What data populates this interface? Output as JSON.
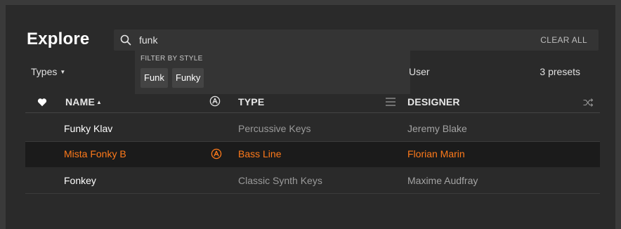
{
  "colors": {
    "accent": "#ff7a1a",
    "panel": "#2a2a2a",
    "selected_row": "#1b1b1b"
  },
  "header": {
    "title": "Explore"
  },
  "search": {
    "value": "funk",
    "clear_label": "CLEAR ALL",
    "icon": "search-icon"
  },
  "filter": {
    "heading": "FILTER BY STYLE",
    "chips": [
      "Funk",
      "Funky"
    ]
  },
  "toolbar": {
    "types_label": "Types",
    "user_label": "User",
    "preset_count": "3 presets"
  },
  "columns": {
    "favorite_icon": "heart-icon",
    "name": "NAME",
    "name_sort_icon": "sort-ascending-icon",
    "arturia_icon": "arturia-logo-icon",
    "type": "TYPE",
    "type_menu_icon": "list-icon",
    "designer": "DESIGNER",
    "shuffle_icon": "shuffle-icon"
  },
  "presets": [
    {
      "name": "Funky Klav",
      "type": "Percussive Keys",
      "designer": "Jeremy Blake",
      "factory": false,
      "selected": false
    },
    {
      "name": "Mista Fonky B",
      "type": "Bass Line",
      "designer": "Florian Marin",
      "factory": true,
      "selected": true
    },
    {
      "name": "Fonkey",
      "type": "Classic Synth Keys",
      "designer": "Maxime Audfray",
      "factory": false,
      "selected": false
    }
  ]
}
